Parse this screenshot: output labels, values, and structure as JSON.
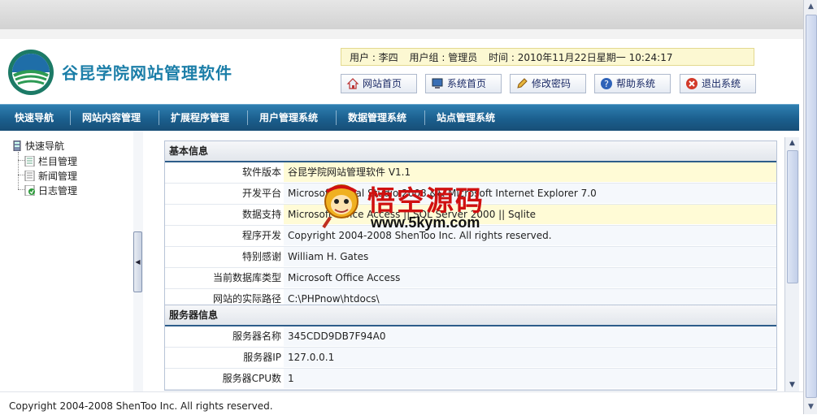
{
  "header": {
    "site_title": "谷昆学院网站管理软件",
    "user_info": {
      "user": "用户 : 李四",
      "group": "用户组 : 管理员",
      "time": "时间 : 2010年11月22日星期一   10:24:17"
    },
    "buttons": [
      {
        "label": "网站首页",
        "icon": "home-icon"
      },
      {
        "label": "系统首页",
        "icon": "computer-icon"
      },
      {
        "label": "修改密码",
        "icon": "pencil-icon"
      },
      {
        "label": "帮助系统",
        "icon": "help-icon"
      },
      {
        "label": "退出系统",
        "icon": "exit-icon"
      }
    ]
  },
  "nav": [
    "快速导航",
    "网站内容管理",
    "扩展程序管理",
    "用户管理系统",
    "数据管理系统",
    "站点管理系统"
  ],
  "sidebar": {
    "root": "快速导航",
    "items": [
      "栏目管理",
      "新闻管理",
      "日志管理"
    ]
  },
  "basic_info": {
    "title": "基本信息",
    "rows": [
      {
        "label": "软件版本",
        "value": "谷昆学院网站管理软件  V1.1"
      },
      {
        "label": "开发平台",
        "value": "Microsoft Visual Studio 2008 && Microsoft Internet Explorer 7.0"
      },
      {
        "label": "数据支持",
        "value": "Microsoft Office Access || SQL Server 2000 || Sqlite"
      },
      {
        "label": "程序开发",
        "value": "Copyright 2004-2008 ShenToo Inc. All rights reserved."
      },
      {
        "label": "特别感谢",
        "value": "William H. Gates"
      },
      {
        "label": "当前数据库类型",
        "value": "Microsoft Office Access"
      },
      {
        "label": "网站的实际路径",
        "value": "C:\\PHPnow\\htdocs\\"
      }
    ]
  },
  "server_info": {
    "title": "服务器信息",
    "rows": [
      {
        "label": "服务器名称",
        "value": "345CDD9DB7F94A0"
      },
      {
        "label": "服务器IP",
        "value": "127.0.0.1"
      },
      {
        "label": "服务器CPU数",
        "value": "1"
      }
    ]
  },
  "watermark": {
    "cn": "悟空源码",
    "url": "www.5kym.com"
  },
  "footer": "Copyright 2004-2008 ShenToo Inc. All rights reserved.",
  "colors": {
    "nav_bg": "#1b5f8e",
    "title_color": "#1b7ea8",
    "userbar_bg": "#fcf8d2",
    "watermark_red": "#d01010"
  }
}
